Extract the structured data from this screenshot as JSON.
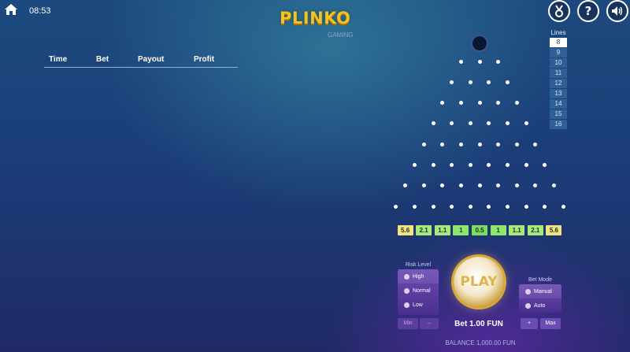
{
  "header": {
    "time": "08:53",
    "logo": "PLINKO",
    "logo_sub": "GAMING",
    "icons": [
      "home-icon",
      "medal-icon",
      "help-icon",
      "sound-icon"
    ],
    "help_label": "?"
  },
  "history": {
    "columns": [
      "Time",
      "Bet",
      "Payout",
      "Profit"
    ],
    "rows": []
  },
  "lines": {
    "title": "Lines",
    "options": [
      "8",
      "9",
      "10",
      "11",
      "12",
      "13",
      "14",
      "15",
      "16"
    ],
    "selected": "8"
  },
  "board": {
    "rows": 8,
    "multipliers": [
      "5.6",
      "2.1",
      "1.1",
      "1",
      "0.5",
      "1",
      "1.1",
      "2.1",
      "5.6"
    ],
    "multiplier_colors": [
      "#f0e47a",
      "#a8ea7a",
      "#a8ea7a",
      "#8ee66b",
      "#7fdc5a",
      "#8ee66b",
      "#a8ea7a",
      "#a8ea7a",
      "#f0e47a"
    ]
  },
  "risk": {
    "title": "Risk Level",
    "options": [
      "High",
      "Normal",
      "Low"
    ],
    "icons": [
      "high-risk-icon",
      "normal-risk-icon",
      "low-risk-icon"
    ]
  },
  "bet_mode": {
    "title": "Bet Mode",
    "options": [
      "Manual",
      "Auto"
    ],
    "icons": [
      "manual-icon",
      "auto-icon"
    ]
  },
  "controls": {
    "play": "PLAY",
    "bet": "Bet 1.00 FUN",
    "min": "Min",
    "minus": "–",
    "plus": "+",
    "max": "Max",
    "balance": "BALANCE 1,000.00 FUN"
  }
}
